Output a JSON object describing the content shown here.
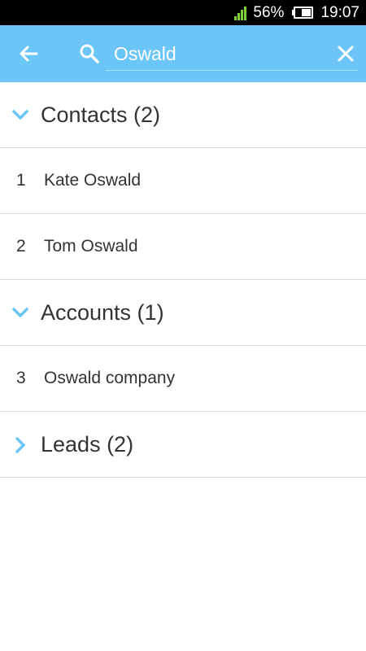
{
  "status_bar": {
    "battery": "56%",
    "time": "19:07",
    "signal_color": "#7fd13b"
  },
  "toolbar": {
    "search_value": "Oswald",
    "accent_color": "#6cc5f7"
  },
  "sections": [
    {
      "title": "Contacts (2)",
      "expanded": true,
      "items": [
        {
          "num": "1",
          "name": "Kate Oswald"
        },
        {
          "num": "2",
          "name": "Tom Oswald"
        }
      ]
    },
    {
      "title": "Accounts (1)",
      "expanded": true,
      "items": [
        {
          "num": "3",
          "name": "Oswald company"
        }
      ]
    },
    {
      "title": "Leads (2)",
      "expanded": false,
      "items": []
    }
  ]
}
